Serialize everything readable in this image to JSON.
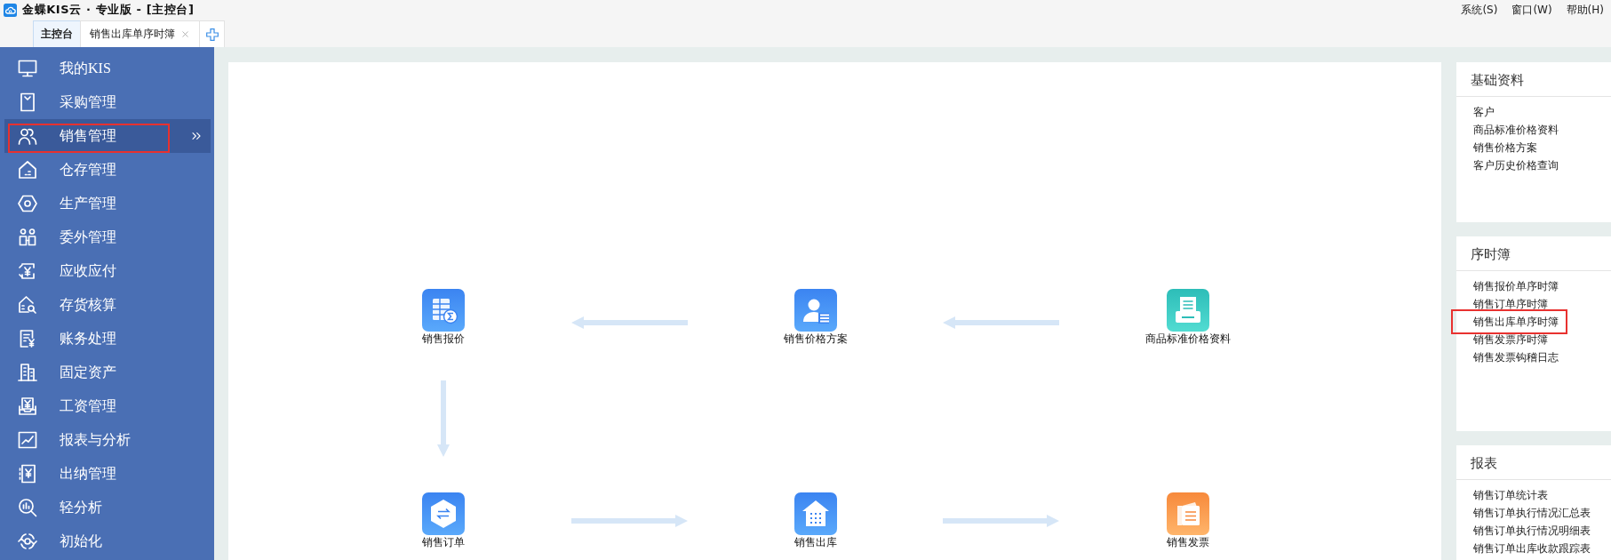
{
  "window": {
    "title": "金蝶KIS云 · 专业版 - [主控台]"
  },
  "menu": [
    "系统(S)",
    "窗口(W)",
    "帮助(H)"
  ],
  "tabs": [
    {
      "label": "主控台",
      "selected": true,
      "closable": false
    },
    {
      "label": "销售出库单序时簿",
      "selected": false,
      "closable": true
    }
  ],
  "sidebar": {
    "items": [
      {
        "label": "我的KIS",
        "selected": false,
        "highlighted": false
      },
      {
        "label": "采购管理",
        "selected": false,
        "highlighted": false
      },
      {
        "label": "销售管理",
        "selected": true,
        "highlighted": true
      },
      {
        "label": "仓存管理",
        "selected": false,
        "highlighted": false
      },
      {
        "label": "生产管理",
        "selected": false,
        "highlighted": false
      },
      {
        "label": "委外管理",
        "selected": false,
        "highlighted": false
      },
      {
        "label": "应收应付",
        "selected": false,
        "highlighted": false
      },
      {
        "label": "存货核算",
        "selected": false,
        "highlighted": false
      },
      {
        "label": "账务处理",
        "selected": false,
        "highlighted": false
      },
      {
        "label": "固定资产",
        "selected": false,
        "highlighted": false
      },
      {
        "label": "工资管理",
        "selected": false,
        "highlighted": false
      },
      {
        "label": "报表与分析",
        "selected": false,
        "highlighted": false
      },
      {
        "label": "出纳管理",
        "selected": false,
        "highlighted": false
      },
      {
        "label": "轻分析",
        "selected": false,
        "highlighted": false
      },
      {
        "label": "初始化",
        "selected": false,
        "highlighted": false
      }
    ]
  },
  "flow": {
    "nodes": [
      {
        "label": "销售报价"
      },
      {
        "label": "销售价格方案"
      },
      {
        "label": "商品标准价格资料"
      },
      {
        "label": "销售订单"
      },
      {
        "label": "销售出库"
      },
      {
        "label": "销售发票"
      }
    ]
  },
  "panels": [
    {
      "title": "基础资料",
      "items": [
        {
          "label": "客户",
          "highlighted": false
        },
        {
          "label": "商品标准价格资料",
          "highlighted": false
        },
        {
          "label": "销售价格方案",
          "highlighted": false
        },
        {
          "label": "客户历史价格查询",
          "highlighted": false
        }
      ]
    },
    {
      "title": "序时簿",
      "items": [
        {
          "label": "销售报价单序时簿",
          "highlighted": false
        },
        {
          "label": "销售订单序时簿",
          "highlighted": false
        },
        {
          "label": "销售出库单序时簿",
          "highlighted": true
        },
        {
          "label": "销售发票序时簿",
          "highlighted": false
        },
        {
          "label": "销售发票钩稽日志",
          "highlighted": false
        }
      ]
    },
    {
      "title": "报表",
      "items": [
        {
          "label": "销售订单统计表",
          "highlighted": false
        },
        {
          "label": "销售订单执行情况汇总表",
          "highlighted": false
        },
        {
          "label": "销售订单执行情况明细表",
          "highlighted": false
        },
        {
          "label": "销售订单出库收款跟踪表",
          "highlighted": false
        }
      ]
    }
  ]
}
